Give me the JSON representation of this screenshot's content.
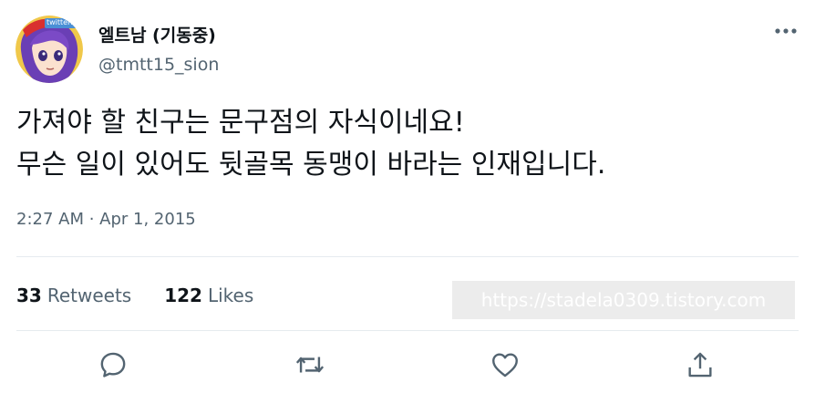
{
  "tweet": {
    "author": {
      "display_name": "엘트남 (기동중)",
      "handle": "@tmtt15_sion",
      "avatar_icon": "anime-character-avatar",
      "avatar_badge_text": "twitter20"
    },
    "text_lines": [
      "가져야 할 친구는 문구점의 자식이네요!",
      "무슨 일이 있어도 뒷골목 동맹이 바라는 인재입니다."
    ],
    "timestamp": "2:27 AM · Apr 1, 2015",
    "stats": {
      "retweets_count": "33",
      "retweets_label": "Retweets",
      "likes_count": "122",
      "likes_label": "Likes"
    },
    "watermark": "https://stadela0309.tistory.com",
    "actions": [
      "reply-icon",
      "retweet-icon",
      "like-icon",
      "share-icon"
    ],
    "more_icon": "more-horizontal-icon"
  },
  "colors": {
    "text_primary": "#0f1419",
    "text_secondary": "#536471",
    "icon": "#536471",
    "divider": "#e6ebef"
  }
}
